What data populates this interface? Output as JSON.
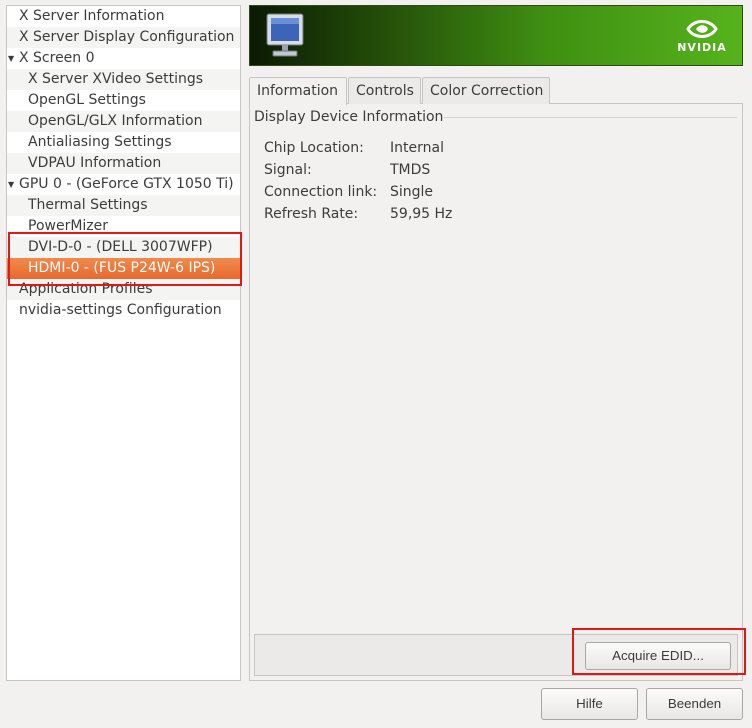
{
  "sidebar": {
    "items": [
      {
        "label": "X Server Information",
        "level": 0,
        "expander": ""
      },
      {
        "label": "X Server Display Configuration",
        "level": 0,
        "expander": ""
      },
      {
        "label": "X Screen 0",
        "level": 0,
        "expander": "▼"
      },
      {
        "label": "X Server XVideo Settings",
        "level": 1,
        "expander": ""
      },
      {
        "label": "OpenGL Settings",
        "level": 1,
        "expander": ""
      },
      {
        "label": "OpenGL/GLX Information",
        "level": 1,
        "expander": ""
      },
      {
        "label": "Antialiasing Settings",
        "level": 1,
        "expander": ""
      },
      {
        "label": "VDPAU Information",
        "level": 1,
        "expander": ""
      },
      {
        "label": "GPU 0 - (GeForce GTX 1050 Ti)",
        "level": 0,
        "expander": "▼"
      },
      {
        "label": "Thermal Settings",
        "level": 1,
        "expander": ""
      },
      {
        "label": "PowerMizer",
        "level": 1,
        "expander": ""
      },
      {
        "label": "DVI-D-0 - (DELL 3007WFP)",
        "level": 1,
        "expander": ""
      },
      {
        "label": "HDMI-0 - (FUS P24W-6 IPS)",
        "level": 1,
        "expander": "",
        "selected": true
      },
      {
        "label": "Application Profiles",
        "level": 0,
        "expander": ""
      },
      {
        "label": "nvidia-settings Configuration",
        "level": 0,
        "expander": ""
      }
    ]
  },
  "banner": {
    "logo_text": "NVIDIA"
  },
  "tabs": [
    {
      "label": "Information",
      "active": true
    },
    {
      "label": "Controls",
      "active": false
    },
    {
      "label": "Color Correction",
      "active": false
    }
  ],
  "display_info": {
    "frame_title": "Display Device Information",
    "rows": [
      {
        "label": "Chip Location:",
        "value": "Internal"
      },
      {
        "label": "Signal:",
        "value": "TMDS"
      },
      {
        "label": "Connection link:",
        "value": "Single"
      },
      {
        "label": "Refresh Rate:",
        "value": "59,95 Hz"
      }
    ]
  },
  "buttons": {
    "acquire_edid": "Acquire EDID...",
    "help": "Hilfe",
    "quit": "Beenden"
  },
  "colors": {
    "selection": "#e8692f",
    "annotation": "#e01818",
    "nvidia_green": "#56b31c"
  }
}
